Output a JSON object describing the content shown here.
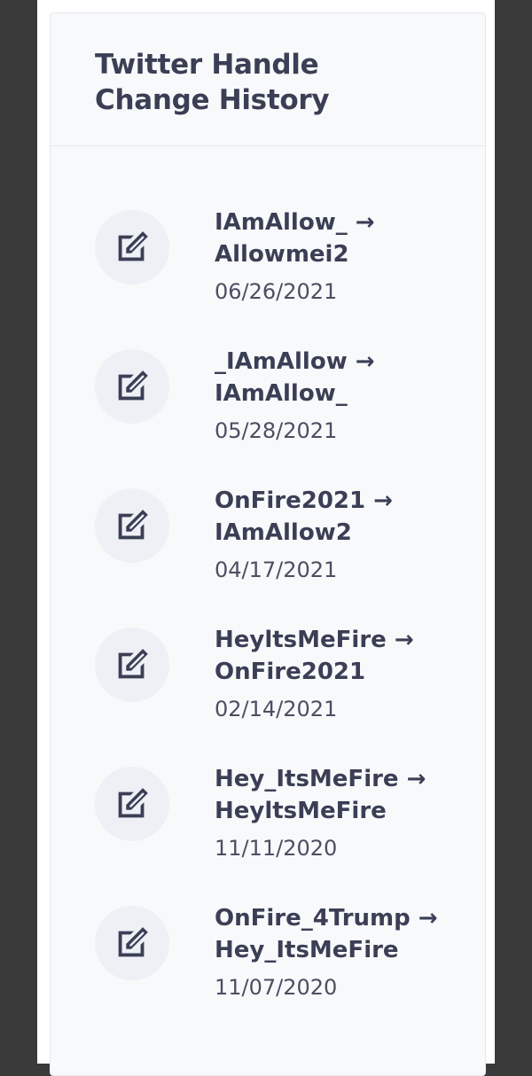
{
  "card": {
    "title": "Twitter Handle Change History"
  },
  "items": [
    {
      "change": "IAmAllow_ → Allowmei2",
      "date": "06/26/2021"
    },
    {
      "change": "_IAmAllow → IAmAllow_",
      "date": "05/28/2021"
    },
    {
      "change": "OnFire2021 → IAmAllow2",
      "date": "04/17/2021"
    },
    {
      "change": "HeyltsMeFire → OnFire2021",
      "date": "02/14/2021"
    },
    {
      "change": "Hey_ItsMeFire → HeyltsMeFire",
      "date": "11/11/2020"
    },
    {
      "change": "OnFire_4Trump → Hey_ItsMeFire",
      "date": "11/07/2020"
    }
  ],
  "icons": {
    "item_icon": "edit-icon"
  },
  "colors": {
    "background_outer": "#3a3a3a",
    "card_bg": "#f8f9fb",
    "icon_circle": "#eef0f5",
    "text_primary": "#3a3f55"
  }
}
